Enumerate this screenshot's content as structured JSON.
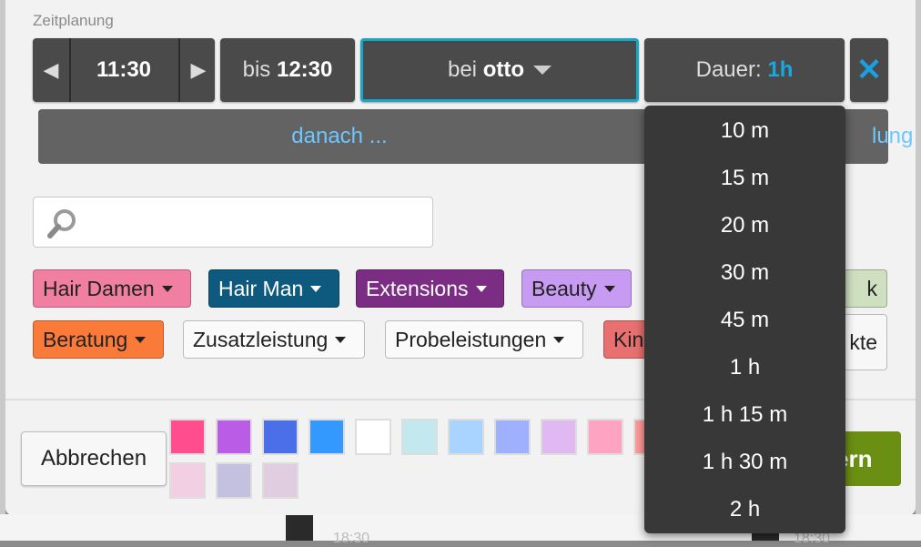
{
  "background": {
    "times": [
      "18:30",
      "18:30"
    ]
  },
  "dialog": {
    "section_label": "Zeitplanung",
    "time": {
      "start": "11:30",
      "prev_icon": "triangle-left-icon",
      "next_icon": "triangle-right-icon"
    },
    "end_prefix": "bis",
    "end_time": "12:30",
    "employee_prefix": "bei",
    "employee": "otto",
    "duration_prefix": "Dauer:",
    "duration_value": "1h",
    "close_icon": "close-icon",
    "after_label": "danach ...",
    "after_label_right": "lung",
    "search": {
      "value": "",
      "placeholder": "",
      "icon": "search-icon"
    },
    "categories_row1": [
      {
        "label": "Hair Damen",
        "color": "#f07fa2",
        "text": "#222"
      },
      {
        "label": "Hair Man",
        "color": "#0e5a7e",
        "text": "#fff"
      },
      {
        "label": "Extensions",
        "color": "#7b2d84",
        "text": "#fff"
      },
      {
        "label": "Beauty",
        "color": "#c79bf2",
        "text": "#222"
      },
      {
        "label": "k",
        "color": "#cfe0c0",
        "text": "#222"
      }
    ],
    "categories_row2": [
      {
        "label": "Beratung",
        "color": "#fa7a3a",
        "text": "#222"
      },
      {
        "label": "Zusatzleistung",
        "color": "#fafafa",
        "text": "#222"
      },
      {
        "label": "Probeleistungen",
        "color": "#fafafa",
        "text": "#222"
      },
      {
        "label": "Kin",
        "color": "#e87070",
        "text": "#222"
      },
      {
        "label": "kte",
        "color": "#f7f7f7",
        "text": "#222"
      }
    ],
    "cancel_label": "Abbrechen",
    "save_label": "ern",
    "swatches": [
      "#ff4d8d",
      "#bb5ce6",
      "#4a6fe8",
      "#3399ff",
      "#ffffff",
      "#c3e8ee",
      "#a9d4ff",
      "#9fb0ff",
      "#e0b8f2",
      "#ffa3c2",
      "#ff9a9a",
      "#f2cfe3",
      "#c3c0e0",
      "#e0cde0"
    ]
  },
  "duration_dropdown": {
    "options": [
      "10 m",
      "15 m",
      "20 m",
      "30 m",
      "45 m",
      "1 h",
      "1 h 15 m",
      "1 h 30 m",
      "2 h"
    ]
  }
}
